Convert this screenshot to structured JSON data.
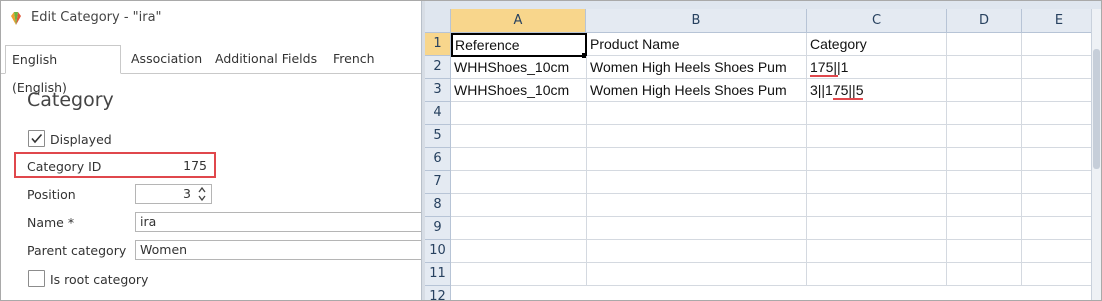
{
  "window": {
    "title": "Edit Category - \"ira\""
  },
  "tabs": [
    {
      "label": "English (English)",
      "active": true
    },
    {
      "label": "Association"
    },
    {
      "label": "Additional Fields"
    },
    {
      "label": "French"
    }
  ],
  "form": {
    "section_title": "Category",
    "displayed": {
      "label": "Displayed",
      "checked": true
    },
    "category_id": {
      "label": "Category ID",
      "value": "175"
    },
    "position": {
      "label": "Position",
      "value": "3"
    },
    "name": {
      "label": "Name *",
      "value": "ira"
    },
    "parent_category": {
      "label": "Parent category",
      "value": "Women"
    },
    "is_root": {
      "label": "Is root category",
      "checked": false
    }
  },
  "sheet": {
    "columns": [
      "A",
      "B",
      "C",
      "D",
      "E"
    ],
    "rows": [
      "1",
      "2",
      "3",
      "4",
      "5",
      "6",
      "7",
      "8",
      "9",
      "10",
      "11",
      "12"
    ],
    "selected_column": "A",
    "selected_row": "1",
    "cells": [
      [
        "Reference",
        "Product Name",
        "Category"
      ],
      [
        "WHHShoes_10cm",
        "Women High Heels Shoes Pum",
        "175||1"
      ],
      [
        "WHHShoes_10cm",
        "Women High Heels Shoes Pum",
        "3||175||5"
      ]
    ]
  },
  "colors": {
    "highlight": "#e0474c",
    "selected_header": "#f8d68c",
    "header_bg": "#e4eaf2"
  },
  "icons": {
    "app_logo": "prestashop-logo-icon",
    "checkbox": "checkmark-icon",
    "spinner": "up-down-arrows-icon"
  }
}
